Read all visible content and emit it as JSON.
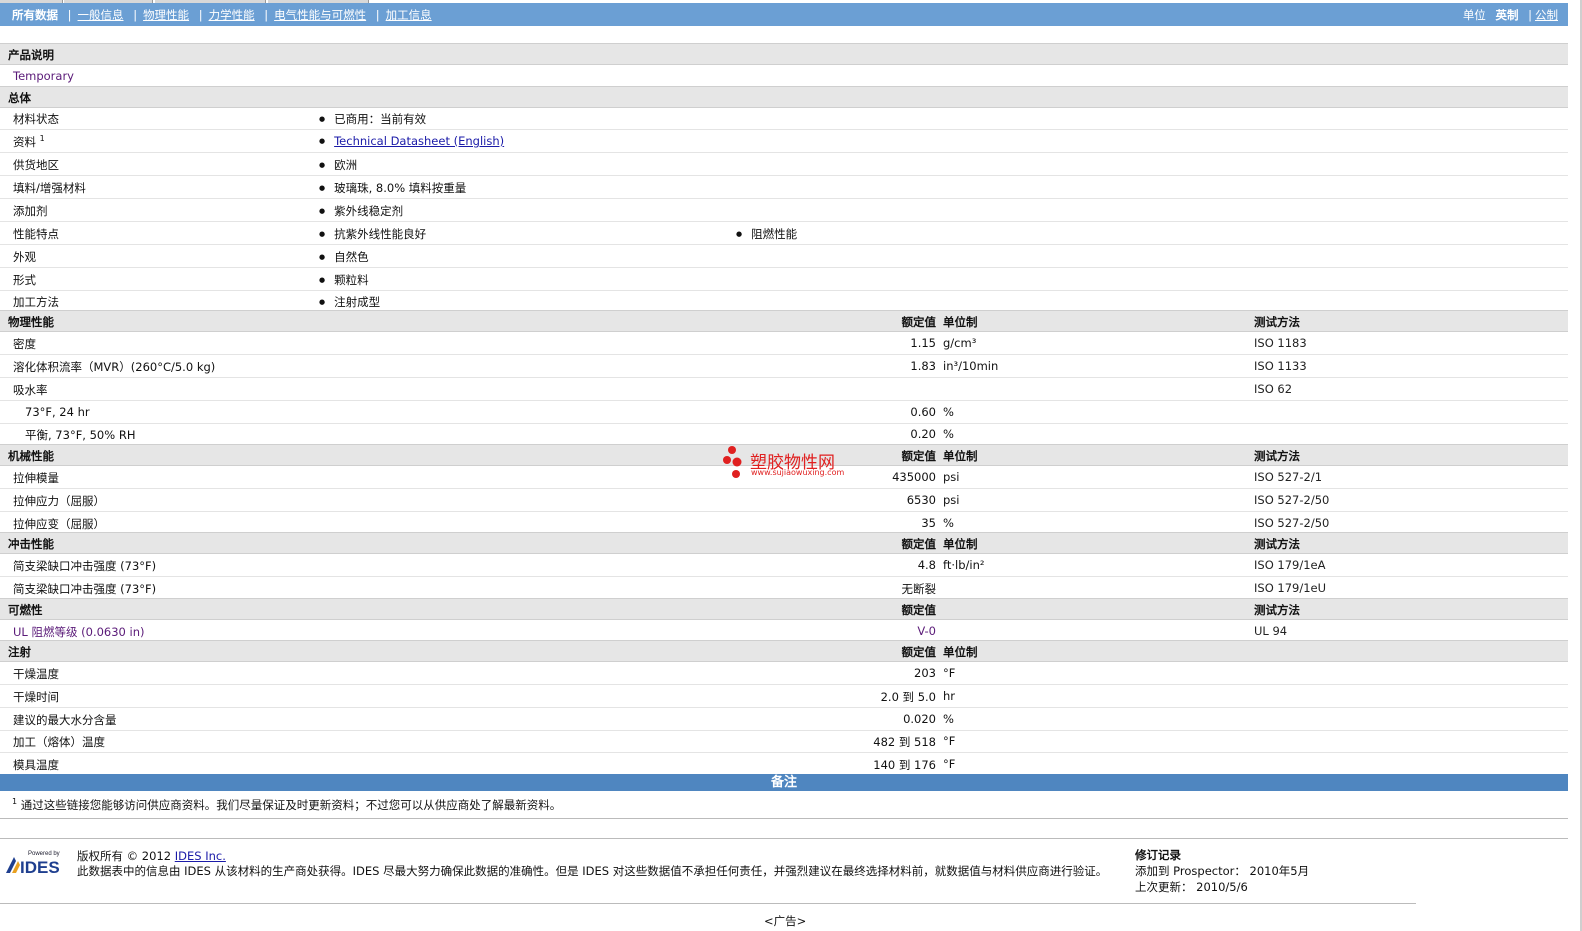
{
  "nav": {
    "current": "所有数据",
    "tabs": [
      "一般信息",
      "物理性能",
      "力学性能",
      "电气性能与可燃性",
      "加工信息"
    ],
    "units_label": "单位",
    "units_selected": "英制",
    "units_other": "公制"
  },
  "product_desc": {
    "title": "产品说明",
    "text": "Temporary"
  },
  "general": {
    "title": "总体",
    "rows": [
      {
        "label": "材料状态",
        "value": "已商用：当前有效"
      },
      {
        "label": "资料",
        "sup": "1",
        "value": "Technical Datasheet (English)"
      },
      {
        "label": "供货地区",
        "value": "欧洲"
      },
      {
        "label": "填料/增强材料",
        "value": "玻璃珠, 8.0% 填料按重量"
      },
      {
        "label": "添加剂",
        "value": "紫外线稳定剂"
      },
      {
        "label": "性能特点",
        "value": "抗紫外线性能良好",
        "value2": "阻燃性能"
      },
      {
        "label": "外观",
        "value": "自然色"
      },
      {
        "label": "形式",
        "value": "颗粒料"
      },
      {
        "label": "加工方法",
        "value": "注射成型"
      }
    ]
  },
  "headers": {
    "nominal": "额定值",
    "unit": "单位制",
    "method": "测试方法"
  },
  "physical": {
    "title": "物理性能",
    "rows": [
      {
        "label": "密度",
        "value": "1.15",
        "unit": "g/cm³",
        "method": "ISO 1183"
      },
      {
        "label": "溶化体积流率（MVR）(260°C/5.0 kg)",
        "value": "1.83",
        "unit": "in³/10min",
        "method": "ISO 1133"
      },
      {
        "label": "吸水率",
        "value": "",
        "unit": "",
        "method": "ISO 62"
      },
      {
        "label": "73°F, 24 hr",
        "value": "0.60",
        "unit": "%",
        "method": ""
      },
      {
        "label": "平衡, 73°F, 50% RH",
        "value": "0.20",
        "unit": "%",
        "method": ""
      }
    ]
  },
  "mechanical": {
    "title": "机械性能",
    "rows": [
      {
        "label": "拉伸模量",
        "value": "435000",
        "unit": "psi",
        "method": "ISO 527-2/1"
      },
      {
        "label": "拉伸应力（屈服）",
        "value": "6530",
        "unit": "psi",
        "method": "ISO 527-2/50"
      },
      {
        "label": "拉伸应变（屈服）",
        "value": "35",
        "unit": "%",
        "method": "ISO 527-2/50"
      }
    ]
  },
  "impact": {
    "title": "冲击性能",
    "rows": [
      {
        "label": "简支梁缺口冲击强度 (73°F)",
        "value": "4.8",
        "unit": "ft·lb/in²",
        "method": "ISO 179/1eA"
      },
      {
        "label": "简支梁缺口冲击强度 (73°F)",
        "value": "无断裂",
        "unit": "",
        "method": "ISO 179/1eU"
      }
    ]
  },
  "flammability": {
    "title": "可燃性",
    "rows": [
      {
        "label": "UL 阻燃等级 (0.0630 in)",
        "value": "V-0",
        "unit": "",
        "method": "UL 94"
      }
    ]
  },
  "injection": {
    "title": "注射",
    "rows": [
      {
        "label": "干燥温度",
        "value": "203",
        "unit": "°F"
      },
      {
        "label": "干燥时间",
        "value": "2.0 到 5.0",
        "unit": "hr"
      },
      {
        "label": "建议的最大水分含量",
        "value": "0.020",
        "unit": "%"
      },
      {
        "label": "加工（熔体）温度",
        "value": "482 到 518",
        "unit": "°F"
      },
      {
        "label": "模具温度",
        "value": "140 到 176",
        "unit": "°F"
      }
    ]
  },
  "notes": {
    "title": "备注",
    "footnote_sup": "1",
    "footnote": "通过这些链接您能够访问供应商资料。我们尽量保证及时更新资料；不过您可以从供应商处了解最新资料。"
  },
  "footer": {
    "logo_small": "Powered by",
    "logo_big": "IDES",
    "copyright_prefix": "版权所有 © 2012",
    "company": "IDES Inc.",
    "disclaimer": "此数据表中的信息由 IDES 从该材料的生产商处获得。IDES 尽最大努力确保此数据的准确性。但是 IDES 对这些数据值不承担任何责任，并强烈建议在最终选择材料前，就数据值与材料供应商进行验证。",
    "rev_title": "修订记录",
    "added_label": "添加到 Prospector：",
    "added_value": "2010年5月",
    "updated_label": "上次更新：",
    "updated_value": "2010/5/6",
    "ad": "<广告>"
  },
  "watermark": {
    "cn": "塑胶物性网",
    "url": "www.sujiaowuxing.com",
    "color": "#e02020"
  }
}
